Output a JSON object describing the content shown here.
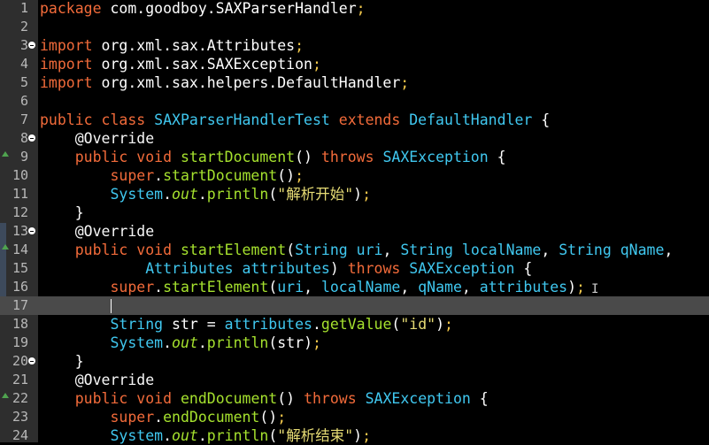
{
  "editor": {
    "language": "java",
    "current_line": 17,
    "lines": [
      {
        "n": "1",
        "fold": false,
        "ov": false,
        "tokens": [
          [
            "k",
            "package"
          ],
          [
            "p",
            " com.goodboy.SAXParserHandler"
          ],
          [
            "pn",
            ";"
          ]
        ]
      },
      {
        "n": "2",
        "fold": false,
        "ov": false,
        "tokens": []
      },
      {
        "n": "3",
        "fold": true,
        "ov": false,
        "tokens": [
          [
            "k",
            "import"
          ],
          [
            "p",
            " org.xml.sax.Attributes"
          ],
          [
            "pn",
            ";"
          ]
        ]
      },
      {
        "n": "4",
        "fold": false,
        "ov": false,
        "tokens": [
          [
            "k",
            "import"
          ],
          [
            "p",
            " org.xml.sax.SAXException"
          ],
          [
            "pn",
            ";"
          ]
        ]
      },
      {
        "n": "5",
        "fold": false,
        "ov": false,
        "tokens": [
          [
            "k",
            "import"
          ],
          [
            "p",
            " org.xml.sax.helpers.DefaultHandler"
          ],
          [
            "pn",
            ";"
          ]
        ]
      },
      {
        "n": "6",
        "fold": false,
        "ov": false,
        "tokens": []
      },
      {
        "n": "7",
        "fold": false,
        "ov": false,
        "tokens": [
          [
            "k",
            "public class "
          ],
          [
            "t",
            "SAXParserHandlerTest"
          ],
          [
            "k",
            " extends "
          ],
          [
            "t",
            "DefaultHandler"
          ],
          [
            "p",
            " {"
          ]
        ]
      },
      {
        "n": "8",
        "fold": true,
        "ov": false,
        "tokens": [
          [
            "p",
            "    "
          ],
          [
            "a",
            "@Override"
          ]
        ]
      },
      {
        "n": "9",
        "fold": false,
        "ov": true,
        "tokens": [
          [
            "p",
            "    "
          ],
          [
            "k",
            "public void "
          ],
          [
            "m",
            "startDocument"
          ],
          [
            "p",
            "() "
          ],
          [
            "k",
            "throws "
          ],
          [
            "t",
            "SAXException"
          ],
          [
            "p",
            " {"
          ]
        ]
      },
      {
        "n": "10",
        "fold": false,
        "ov": false,
        "tokens": [
          [
            "p",
            "        "
          ],
          [
            "k",
            "super"
          ],
          [
            "p",
            "."
          ],
          [
            "m",
            "startDocument"
          ],
          [
            "p",
            "()"
          ],
          [
            "pn",
            ";"
          ]
        ]
      },
      {
        "n": "11",
        "fold": false,
        "ov": false,
        "tokens": [
          [
            "p",
            "        "
          ],
          [
            "t",
            "System"
          ],
          [
            "p",
            "."
          ],
          [
            "i",
            "out"
          ],
          [
            "p",
            "."
          ],
          [
            "m",
            "println"
          ],
          [
            "p",
            "("
          ],
          [
            "s",
            "\"解析开始\""
          ],
          [
            "p",
            ")"
          ],
          [
            "pn",
            ";"
          ]
        ]
      },
      {
        "n": "12",
        "fold": false,
        "ov": false,
        "tokens": [
          [
            "p",
            "    }"
          ]
        ]
      },
      {
        "n": "13",
        "fold": true,
        "ov": false,
        "tokens": [
          [
            "p",
            "    "
          ],
          [
            "a",
            "@Override"
          ]
        ]
      },
      {
        "n": "14",
        "fold": false,
        "ov": true,
        "tokens": [
          [
            "p",
            "    "
          ],
          [
            "k",
            "public void "
          ],
          [
            "m",
            "startElement"
          ],
          [
            "p",
            "("
          ],
          [
            "t",
            "String"
          ],
          [
            "pm",
            " uri"
          ],
          [
            "p",
            ", "
          ],
          [
            "t",
            "String"
          ],
          [
            "pm",
            " localName"
          ],
          [
            "p",
            ", "
          ],
          [
            "t",
            "String"
          ],
          [
            "pm",
            " qName"
          ],
          [
            "p",
            ","
          ]
        ]
      },
      {
        "n": "15",
        "fold": false,
        "ov": false,
        "tokens": [
          [
            "p",
            "            "
          ],
          [
            "t",
            "Attributes"
          ],
          [
            "pm",
            " attributes"
          ],
          [
            "p",
            ") "
          ],
          [
            "k",
            "throws "
          ],
          [
            "t",
            "SAXException"
          ],
          [
            "p",
            " {"
          ]
        ]
      },
      {
        "n": "16",
        "fold": false,
        "ov": false,
        "tokens": [
          [
            "p",
            "        "
          ],
          [
            "k",
            "super"
          ],
          [
            "p",
            "."
          ],
          [
            "m",
            "startElement"
          ],
          [
            "p",
            "("
          ],
          [
            "pm",
            "uri"
          ],
          [
            "p",
            ", "
          ],
          [
            "pm",
            "localName"
          ],
          [
            "p",
            ", "
          ],
          [
            "pm",
            "qName"
          ],
          [
            "p",
            ", "
          ],
          [
            "pm",
            "attributes"
          ],
          [
            "p",
            ")"
          ],
          [
            "pn",
            ";"
          ]
        ]
      },
      {
        "n": "17",
        "fold": false,
        "ov": false,
        "tokens": []
      },
      {
        "n": "18",
        "fold": false,
        "ov": false,
        "tokens": [
          [
            "p",
            "        "
          ],
          [
            "t",
            "String"
          ],
          [
            "p",
            " str = "
          ],
          [
            "pm",
            "attributes"
          ],
          [
            "p",
            "."
          ],
          [
            "m",
            "getValue"
          ],
          [
            "p",
            "("
          ],
          [
            "s",
            "\"id\""
          ],
          [
            "p",
            ")"
          ],
          [
            "pn",
            ";"
          ]
        ]
      },
      {
        "n": "19",
        "fold": false,
        "ov": false,
        "tokens": [
          [
            "p",
            "        "
          ],
          [
            "t",
            "System"
          ],
          [
            "p",
            "."
          ],
          [
            "i",
            "out"
          ],
          [
            "p",
            "."
          ],
          [
            "m",
            "println"
          ],
          [
            "p",
            "(str)"
          ],
          [
            "pn",
            ";"
          ]
        ]
      },
      {
        "n": "20",
        "fold": true,
        "ov": false,
        "tokens": [
          [
            "p",
            "    }"
          ]
        ]
      },
      {
        "n": "21",
        "fold": false,
        "ov": false,
        "tokens": [
          [
            "p",
            "    "
          ],
          [
            "a",
            "@Override"
          ]
        ]
      },
      {
        "n": "22",
        "fold": false,
        "ov": true,
        "tokens": [
          [
            "p",
            "    "
          ],
          [
            "k",
            "public void "
          ],
          [
            "m",
            "endDocument"
          ],
          [
            "p",
            "() "
          ],
          [
            "k",
            "throws "
          ],
          [
            "t",
            "SAXException"
          ],
          [
            "p",
            " {"
          ]
        ]
      },
      {
        "n": "23",
        "fold": false,
        "ov": false,
        "tokens": [
          [
            "p",
            "        "
          ],
          [
            "k",
            "super"
          ],
          [
            "p",
            "."
          ],
          [
            "m",
            "endDocument"
          ],
          [
            "p",
            "()"
          ],
          [
            "pn",
            ";"
          ]
        ]
      },
      {
        "n": "24",
        "fold": false,
        "ov": false,
        "tokens": [
          [
            "p",
            "        "
          ],
          [
            "t",
            "System"
          ],
          [
            "p",
            "."
          ],
          [
            "i",
            "out"
          ],
          [
            "p",
            "."
          ],
          [
            "m",
            "println"
          ],
          [
            "p",
            "("
          ],
          [
            "s",
            "\"解析结束\""
          ],
          [
            "p",
            ")"
          ],
          [
            "pn",
            ";"
          ]
        ]
      }
    ]
  }
}
